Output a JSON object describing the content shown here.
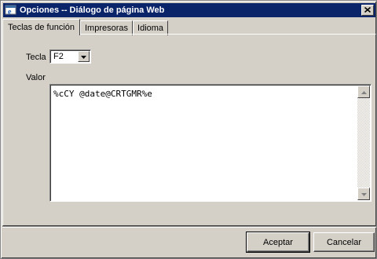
{
  "window": {
    "title": "Opciones -- Diálogo de página Web",
    "title_bar_color": "#0a246a"
  },
  "icons": {
    "app": "ie-window-icon",
    "close": "close-icon",
    "dropdown": "chevron-down-icon",
    "scroll_up": "arrow-up-icon",
    "scroll_down": "arrow-down-icon"
  },
  "tabs": [
    {
      "label": "Teclas de función",
      "active": true
    },
    {
      "label": "Impresoras",
      "active": false
    },
    {
      "label": "Idioma",
      "active": false
    }
  ],
  "form": {
    "tecla_label": "Tecla",
    "tecla_value": "F2",
    "valor_label": "Valor",
    "valor_value": "%cCY @date@CRTGMR%e"
  },
  "buttons": {
    "accept": "Aceptar",
    "cancel": "Cancelar"
  }
}
